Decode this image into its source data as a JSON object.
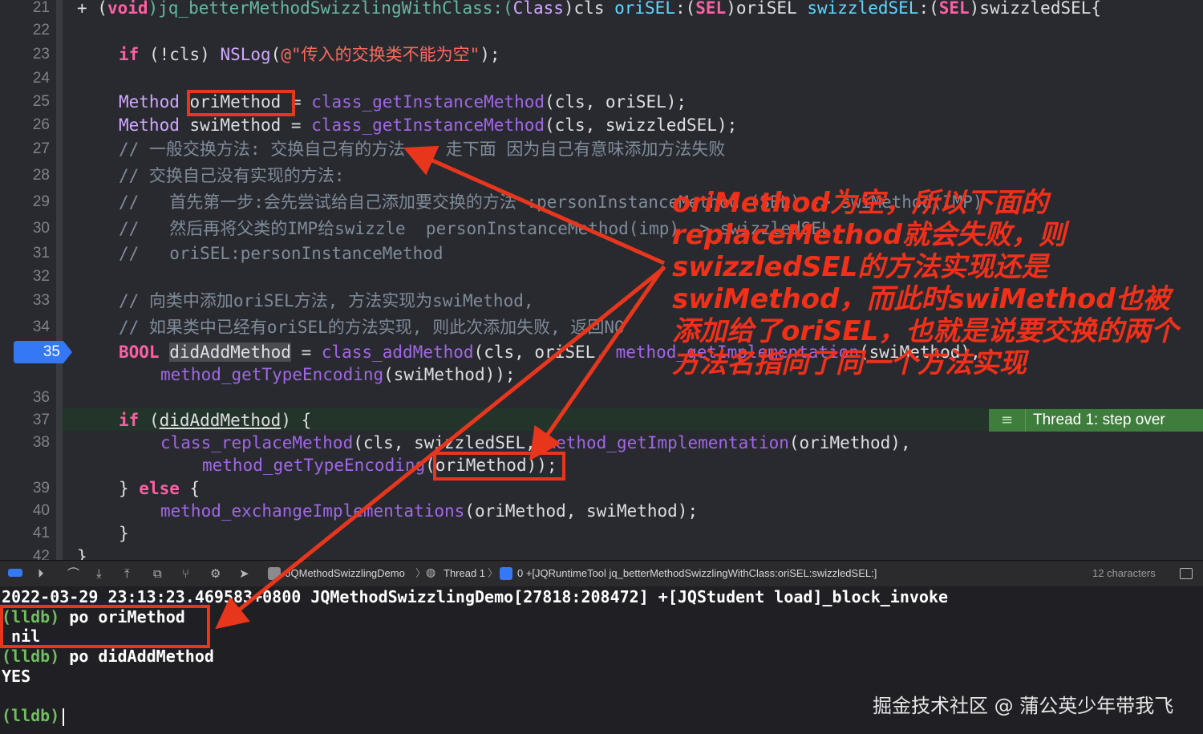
{
  "editor": {
    "line_numbers": [
      "21",
      "22",
      "23",
      "24",
      "25",
      "26",
      "27",
      "28",
      "29",
      "30",
      "31",
      "32",
      "33",
      "34",
      "35",
      "",
      "36",
      "37",
      "38",
      "",
      "39",
      "40",
      "41",
      "42"
    ],
    "active_line": "35",
    "code": {
      "l21_a": "+ (",
      "l21_void": "void",
      "l21_b": ")jq_betterMethodSwizzlingWithClass:(",
      "l21_class": "Class",
      "l21_c": ")cls ",
      "l21_oriSEL": "oriSEL",
      "l21_d": ":(",
      "l21_sel1": "SEL",
      "l21_e": ")oriSEL ",
      "l21_swizzledSEL": "swizzledSEL",
      "l21_f": ":(",
      "l21_sel2": "SEL",
      "l21_g": ")swizzledSEL{",
      "l23_if": "if",
      "l23_a": " (!cls) ",
      "l23_nslog": "NSLog",
      "l23_b": "(",
      "l23_str": "@\"传入的交换类不能为空\"",
      "l23_c": ");",
      "l25_method": "Method",
      "l25_a": " ",
      "l25_var": "oriMethod",
      "l25_b": " = ",
      "l25_fn": "class_getInstanceMethod",
      "l25_c": "(cls, oriSEL);",
      "l26_method": "Method",
      "l26_a": " swiMethod = ",
      "l26_fn": "class_getInstanceMethod",
      "l26_c": "(cls, swizzledSEL);",
      "l27": "// 一般交换方法: 交换自己有的方法 -- 走下面 因为自己有意味添加方法失败",
      "l28": "// 交换自己没有实现的方法:",
      "l29": "//   首先第一步:会先尝试给自己添加要交换的方法 :personInstanceMethod (SEL) -> swiMethod(IMP)",
      "l30": "//   然后再将父类的IMP给swizzle  personInstanceMethod(imp) -> swizzledSEL",
      "l31": "//   oriSEL:personInstanceMethod",
      "l33": "// 向类中添加oriSEL方法, 方法实现为swiMethod,",
      "l34": "// 如果类中已经有oriSEL的方法实现, 则此次添加失败, 返回NO",
      "l35_bool": "BOOL",
      "l35_a": " ",
      "l35_var": "didAddMethod",
      "l35_b": " = ",
      "l35_fn": "class_addMethod",
      "l35_c": "(cls, oriSEL, ",
      "l35_fn2": "method_getImplementation",
      "l35_d": "(swiMethod),",
      "l35b_fn": "method_getTypeEncoding",
      "l35b_a": "(swiMethod));",
      "l37_if": "if",
      "l37_a": " (",
      "l37_var": "didAddMethod",
      "l37_b": ") {",
      "l38_fn": "class_replaceMethod",
      "l38_a": "(cls, swizzledSEL, ",
      "l38_fn2": "method_getImplementation",
      "l38_b": "(oriMethod),",
      "l38b_fn": "method_getTypeEncoding",
      "l38b_a": "(oriMethod));",
      "l39_a": "} ",
      "l39_else": "else",
      "l39_b": " {",
      "l40_fn": "method_exchangeImplementations",
      "l40_a": "(oriMethod, swiMethod);",
      "l41": "}",
      "l42": "}"
    },
    "thread_badge": {
      "icon": "≡",
      "label": "Thread 1: step over"
    }
  },
  "debug_bar": {
    "breadcrumb_target": "JQMethodSwizzlingDemo",
    "breadcrumb_thread": "Thread 1",
    "breadcrumb_frame": "0 +[JQRuntimeTool jq_betterMethodSwizzlingWithClass:oriSEL:swizzledSEL:]",
    "char_count": "12 characters"
  },
  "console": {
    "log_line": "2022-03-29 23:13:23.469583+0800 JQMethodSwizzlingDemo[27818:208472] +[JQStudent load]_block_invoke",
    "prompt": "(lldb)",
    "cmd1": " po oriMethod",
    "out1": " nil",
    "cmd2": " po didAddMethod",
    "out2": "YES"
  },
  "annotation": {
    "text": "oriMethod为空，所以下面的replaceMethod就会失败，则swizzledSEL的方法实现还是swiMethod，而此时swiMethod也被添加给了oriSEL，也就是说要交换的两个方法名指向了同一个方法实现"
  },
  "watermark": "掘金技术社区 @ 蒲公英少年带我飞",
  "colors": {
    "editor_bg": "#292a30",
    "console_bg": "#1f1f24",
    "keyword": "#fc5fa3",
    "function": "#67b7a4",
    "comment": "#7f8c98",
    "string": "#fc6a5d",
    "annotation_red": "#f2301a",
    "thread_green": "#3e7d3c",
    "lldb_green": "#6fbf5c"
  }
}
